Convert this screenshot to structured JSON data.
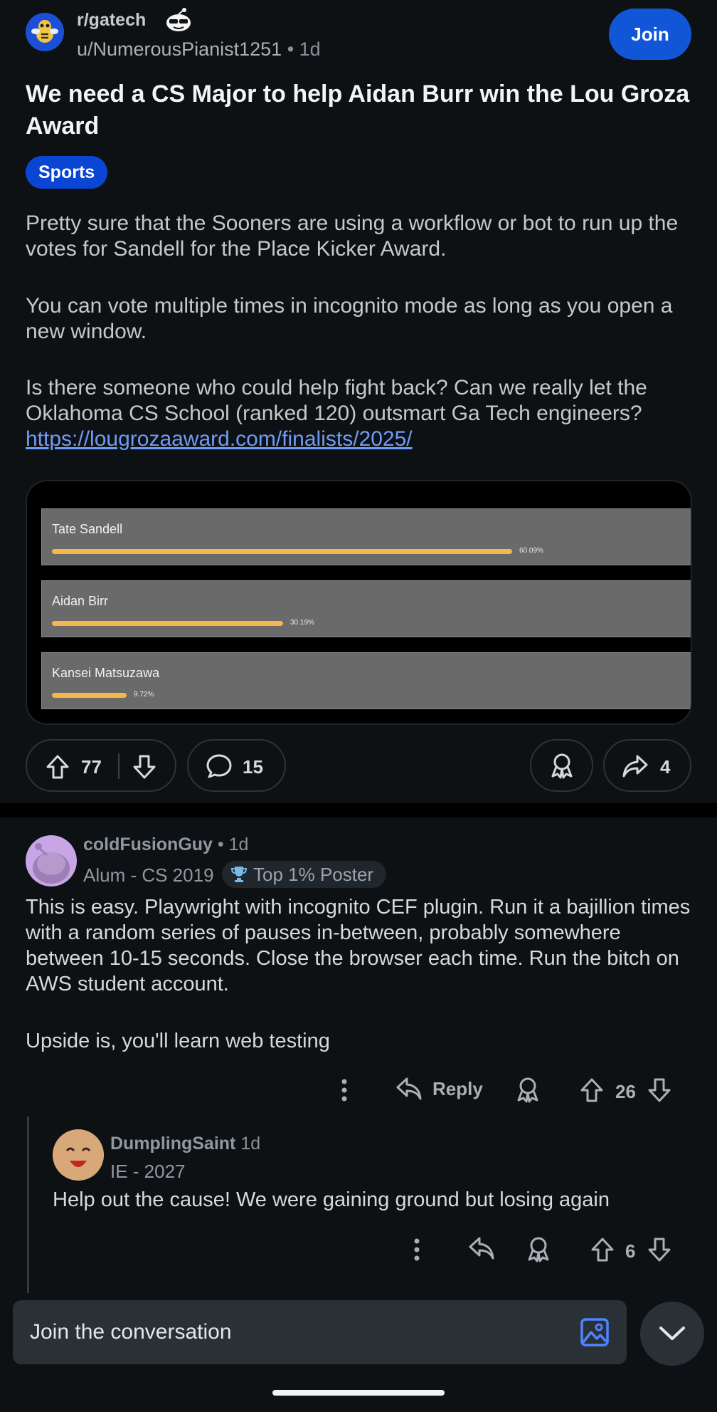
{
  "post": {
    "subreddit": "r/gatech",
    "author": "u/NumerousPianist1251",
    "time": "1d",
    "join_label": "Join",
    "title": "We need a CS Major to help Aidan Burr win the Lou Groza Award",
    "flair": "Sports",
    "paragraphs": [
      "Pretty sure that the Sooners are using a workflow or bot to run up the votes for Sandell for the Place Kicker Award.",
      "You can vote multiple times in incognito mode as long as you open a new window.",
      "Is there someone who could help fight back? Can we really let the Oklahoma CS School (ranked 120) outsmart Ga Tech engineers?"
    ],
    "link": "https://lougrozaaward.com/finalists/2025/",
    "poll": [
      {
        "name": "Tate Sandell",
        "percent_label": "60.09%",
        "fraction": 0.6009
      },
      {
        "name": "Aidan Birr",
        "percent_label": "30.19%",
        "fraction": 0.3019
      },
      {
        "name": "Kansei Matsuzawa",
        "percent_label": "9.72%",
        "fraction": 0.0972
      }
    ],
    "upvotes": "77",
    "comments": "15",
    "shares": "4"
  },
  "comment1": {
    "user": "coldFusionGuy",
    "time": "1d",
    "flair": "Alum - CS 2019",
    "badge": "Top 1% Poster",
    "paragraphs": [
      "This is easy. Playwright with incognito CEF plugin. Run it a bajillion times with a random series of pauses in-between, probably somewhere between 10-15 seconds. Close the browser each time. Run the bitch on AWS student account.",
      "Upside is, you'll learn web testing"
    ],
    "reply_label": "Reply",
    "votes": "26"
  },
  "comment2": {
    "user": "DumplingSaint",
    "time": "1d",
    "flair": "IE - 2027",
    "body": "Help out the cause! We were gaining ground but losing again",
    "votes": "6"
  },
  "composer": {
    "placeholder": "Join the conversation"
  },
  "colors": {
    "accent": "#1256d8",
    "poll_bar": "#f2b84b",
    "background": "#0e1113"
  }
}
